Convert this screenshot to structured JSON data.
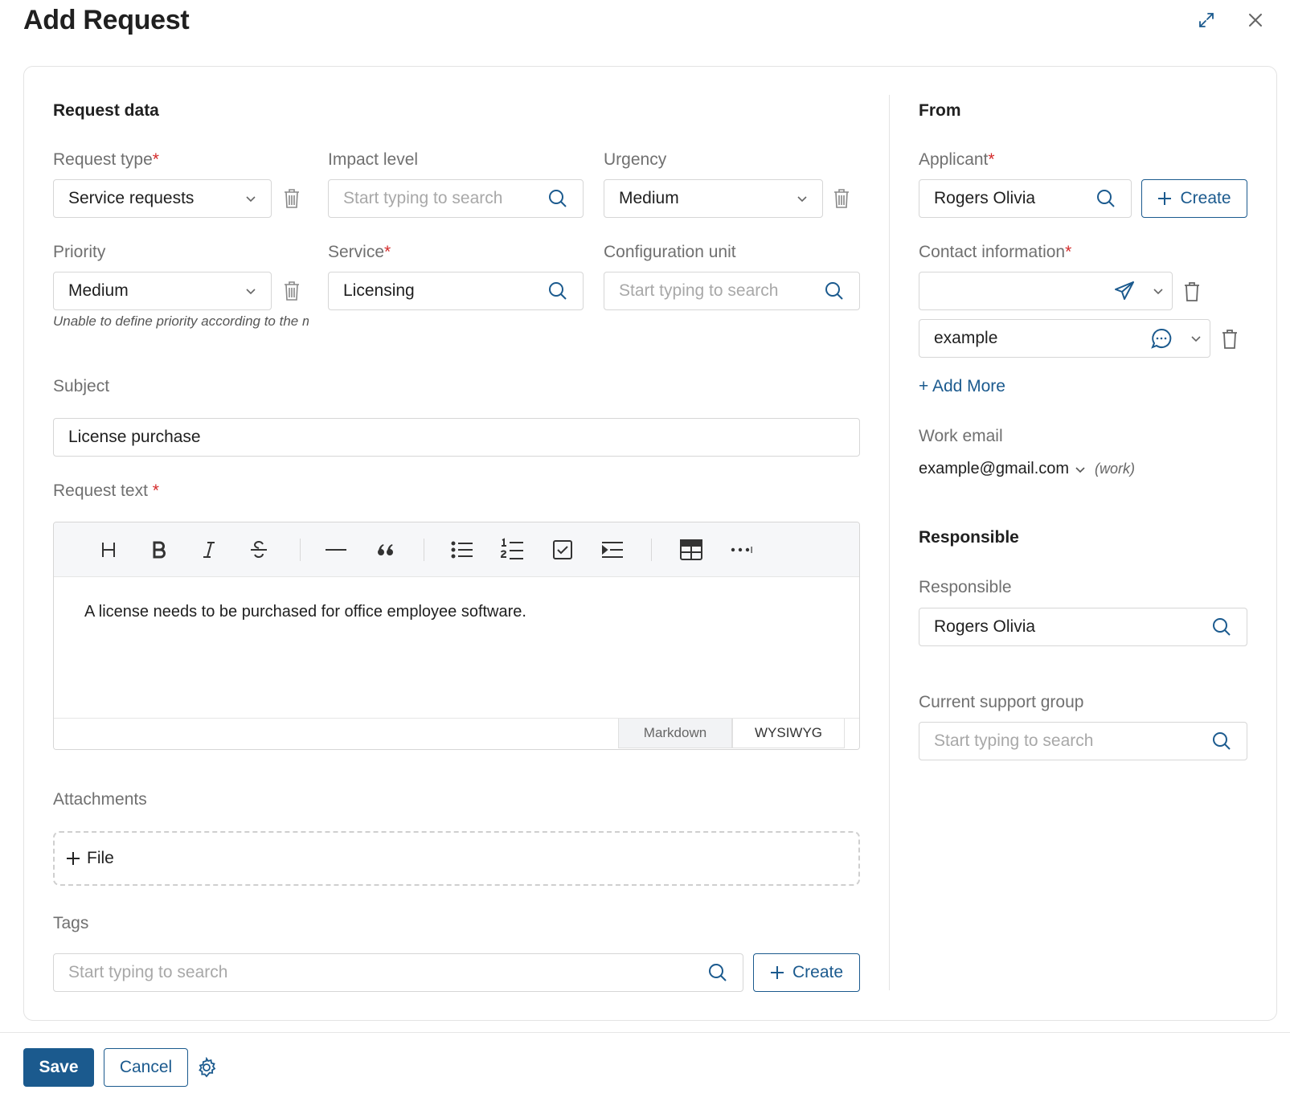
{
  "dialog": {
    "title": "Add Request"
  },
  "request_data": {
    "section_title": "Request data",
    "request_type": {
      "label": "Request type",
      "value": "Service requests"
    },
    "impact_level": {
      "label": "Impact level",
      "placeholder": "Start typing to search"
    },
    "urgency": {
      "label": "Urgency",
      "value": "Medium"
    },
    "priority": {
      "label": "Priority",
      "value": "Medium",
      "hint": "Unable to define priority according to the matrix"
    },
    "service": {
      "label": "Service",
      "value": "Licensing"
    },
    "configuration_unit": {
      "label": "Configuration unit",
      "placeholder": "Start typing to search"
    },
    "subject": {
      "label": "Subject",
      "value": "License purchase"
    },
    "request_text": {
      "label": "Request text",
      "content": "A license needs to be purchased for office employee software.",
      "modes": [
        "Markdown",
        "WYSIWYG"
      ],
      "active_mode": "WYSIWYG"
    },
    "attachments": {
      "label": "Attachments",
      "file_button": "File"
    },
    "tags": {
      "label": "Tags",
      "placeholder": "Start typing to search",
      "create_button": "Create"
    }
  },
  "from": {
    "section_title": "From",
    "applicant": {
      "label": "Applicant",
      "value": "Rogers Olivia",
      "create_button": "Create"
    },
    "contact_information": {
      "label": "Contact information",
      "entries": [
        {
          "value": "",
          "icon": "telegram-send-icon"
        },
        {
          "value": "example",
          "icon": "chat-bubble-icon"
        }
      ],
      "add_more": "+ Add More"
    },
    "work_email": {
      "label": "Work email",
      "value": "example@gmail.com",
      "type": "(work)"
    }
  },
  "responsible": {
    "section_title": "Responsible",
    "responsible": {
      "label": "Responsible",
      "value": "Rogers Olivia"
    },
    "support_group": {
      "label": "Current support group",
      "placeholder": "Start typing to search"
    }
  },
  "footer": {
    "save": "Save",
    "cancel": "Cancel"
  },
  "colors": {
    "accent": "#1b5a8e",
    "required": "#d42b2b",
    "border": "#d6d6d6"
  }
}
